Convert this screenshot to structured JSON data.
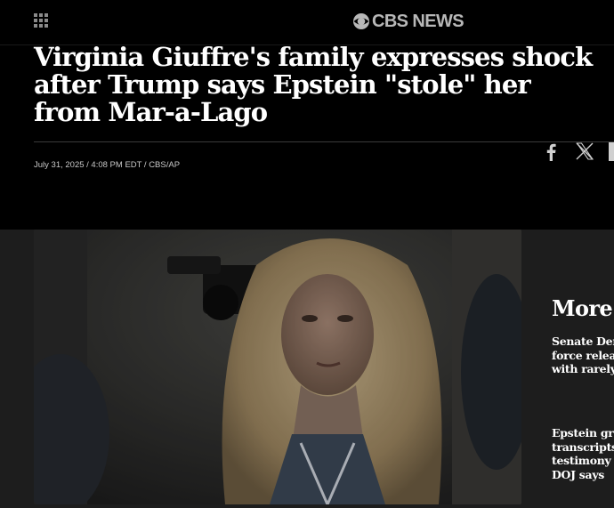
{
  "header": {
    "logo_text": "CBS NEWS",
    "menu_icon": "grid-menu-icon",
    "logo_icon": "cbs-eye-icon"
  },
  "article": {
    "headline": "Virginia Giuffre's family expresses shock after Trump says Epstein \"stole\" her from Mar-a-Lago",
    "meta": "July 31, 2025 / 4:08 PM EDT / CBS/AP"
  },
  "share": {
    "icons": [
      "facebook-icon",
      "x-icon",
      "share-more-icon"
    ]
  },
  "more": {
    "title": "More f",
    "items": [
      {
        "lines": [
          "Senate Dem",
          "force releas",
          "with rarely"
        ]
      },
      {
        "lines": [
          "Epstein gra",
          "transcripts",
          "testimony f",
          "DOJ says"
        ]
      }
    ]
  },
  "colors": {
    "background": "#000000",
    "lower_background": "#1d1d1d",
    "logo": "#b8b8b8",
    "headline": "#ffffff",
    "meta": "#c8c8c8"
  }
}
